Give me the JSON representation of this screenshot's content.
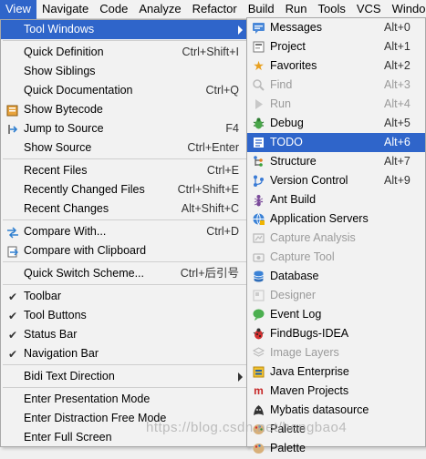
{
  "menubar": {
    "items": [
      "View",
      "Navigate",
      "Code",
      "Analyze",
      "Refactor",
      "Build",
      "Run",
      "Tools",
      "VCS",
      "Windo"
    ]
  },
  "left_menu": {
    "items": [
      {
        "label": "Tool Windows",
        "shortcut": "",
        "icon": "",
        "submenu": true,
        "selected": true
      },
      {
        "label": "Quick Definition",
        "shortcut": "Ctrl+Shift+I",
        "icon": ""
      },
      {
        "label": "Show Siblings",
        "shortcut": "",
        "icon": ""
      },
      {
        "label": "Quick Documentation",
        "shortcut": "Ctrl+Q",
        "icon": ""
      },
      {
        "label": "Show Bytecode",
        "shortcut": "",
        "icon": "bytecode-icon"
      },
      {
        "label": "Jump to Source",
        "shortcut": "F4",
        "icon": "jump-to-source-icon"
      },
      {
        "label": "Show Source",
        "shortcut": "Ctrl+Enter",
        "icon": ""
      },
      {
        "label": "Recent Files",
        "shortcut": "Ctrl+E",
        "icon": ""
      },
      {
        "label": "Recently Changed Files",
        "shortcut": "Ctrl+Shift+E",
        "icon": ""
      },
      {
        "label": "Recent Changes",
        "shortcut": "Alt+Shift+C",
        "icon": ""
      },
      {
        "label": "Compare With...",
        "shortcut": "Ctrl+D",
        "icon": "compare-icon"
      },
      {
        "label": "Compare with Clipboard",
        "shortcut": "",
        "icon": "compare-clipboard-icon"
      },
      {
        "label": "Quick Switch Scheme...",
        "shortcut": "Ctrl+后引号",
        "icon": ""
      },
      {
        "label": "Toolbar",
        "shortcut": "",
        "icon": "check-icon"
      },
      {
        "label": "Tool Buttons",
        "shortcut": "",
        "icon": "check-icon"
      },
      {
        "label": "Status Bar",
        "shortcut": "",
        "icon": "check-icon"
      },
      {
        "label": "Navigation Bar",
        "shortcut": "",
        "icon": "check-icon"
      },
      {
        "label": "Bidi Text Direction",
        "shortcut": "",
        "icon": "",
        "submenu": true
      },
      {
        "label": "Enter Presentation Mode",
        "shortcut": "",
        "icon": ""
      },
      {
        "label": "Enter Distraction Free Mode",
        "shortcut": "",
        "icon": ""
      },
      {
        "label": "Enter Full Screen",
        "shortcut": "",
        "icon": ""
      }
    ]
  },
  "sub_menu": {
    "items": [
      {
        "label": "Messages",
        "shortcut": "Alt+0",
        "icon": "messages-icon"
      },
      {
        "label": "Project",
        "shortcut": "Alt+1",
        "icon": "project-icon"
      },
      {
        "label": "Favorites",
        "shortcut": "Alt+2",
        "icon": "favorites-icon"
      },
      {
        "label": "Find",
        "shortcut": "Alt+3",
        "icon": "find-icon",
        "disabled": true
      },
      {
        "label": "Run",
        "shortcut": "Alt+4",
        "icon": "run-icon",
        "disabled": true
      },
      {
        "label": "Debug",
        "shortcut": "Alt+5",
        "icon": "debug-icon"
      },
      {
        "label": "TODO",
        "shortcut": "Alt+6",
        "icon": "todo-icon",
        "selected": true
      },
      {
        "label": "Structure",
        "shortcut": "Alt+7",
        "icon": "structure-icon"
      },
      {
        "label": "Version Control",
        "shortcut": "Alt+9",
        "icon": "version-control-icon"
      },
      {
        "label": "Ant Build",
        "shortcut": "",
        "icon": "ant-build-icon"
      },
      {
        "label": "Application Servers",
        "shortcut": "",
        "icon": "application-servers-icon"
      },
      {
        "label": "Capture Analysis",
        "shortcut": "",
        "icon": "capture-analysis-icon",
        "disabled": true
      },
      {
        "label": "Capture Tool",
        "shortcut": "",
        "icon": "capture-tool-icon",
        "disabled": true
      },
      {
        "label": "Database",
        "shortcut": "",
        "icon": "database-icon"
      },
      {
        "label": "Designer",
        "shortcut": "",
        "icon": "designer-icon",
        "disabled": true
      },
      {
        "label": "Event Log",
        "shortcut": "",
        "icon": "event-log-icon"
      },
      {
        "label": "FindBugs-IDEA",
        "shortcut": "",
        "icon": "findbugs-icon"
      },
      {
        "label": "Image Layers",
        "shortcut": "",
        "icon": "image-layers-icon",
        "disabled": true
      },
      {
        "label": "Java Enterprise",
        "shortcut": "",
        "icon": "java-enterprise-icon"
      },
      {
        "label": "Maven Projects",
        "shortcut": "",
        "icon": "maven-icon"
      },
      {
        "label": "Mybatis datasource",
        "shortcut": "",
        "icon": "mybatis-icon"
      },
      {
        "label": "Palette",
        "shortcut": "",
        "icon": "palette-icon"
      },
      {
        "label": "Palette",
        "shortcut": "",
        "icon": "palette-icon"
      }
    ]
  },
  "watermark": "https://blog.csdn.net/hengbao4",
  "colors": {
    "selection": "#2f65ca",
    "menu_bg": "#f2f2f2",
    "disabled": "#9a9a9a"
  }
}
